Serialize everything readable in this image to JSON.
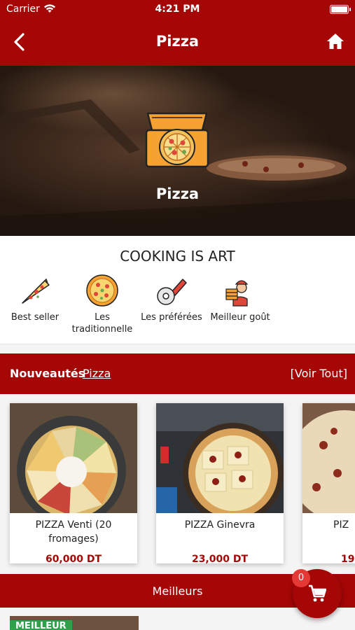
{
  "status_bar": {
    "carrier": "Carrier",
    "time": "4:21 PM"
  },
  "nav": {
    "title": "Pizza",
    "back_icon": "chevron-left-icon",
    "home_icon": "home-icon"
  },
  "hero": {
    "title": "Pizza",
    "logo_icon": "pizza-box-icon"
  },
  "categories": {
    "heading": "COOKING IS ART",
    "items": [
      {
        "label": "Best seller",
        "icon": "pizza-slice-icon"
      },
      {
        "label": "Les traditionnelle",
        "icon": "whole-pizza-icon"
      },
      {
        "label": "Les préférées",
        "icon": "pizza-cutter-icon"
      },
      {
        "label": "Meilleur goût",
        "icon": "pizza-delivery-man-icon"
      }
    ]
  },
  "new_section": {
    "label": "Nouveautés",
    "category": "Pizza",
    "see_all": "[Voir Tout]"
  },
  "products": [
    {
      "name": "PIZZA Venti (20 fromages)",
      "price": "60,000 DT"
    },
    {
      "name": "PIZZA Ginevra",
      "price": "23,000 DT"
    },
    {
      "name": "PIZ",
      "price": "19,"
    }
  ],
  "best_section": {
    "title": "Meilleurs",
    "badge": "MEILLEUR"
  },
  "cart": {
    "count": "0",
    "icon": "shopping-cart-icon"
  },
  "colors": {
    "brand": "#a50606",
    "price": "#a50606",
    "badge": "#e53935"
  }
}
